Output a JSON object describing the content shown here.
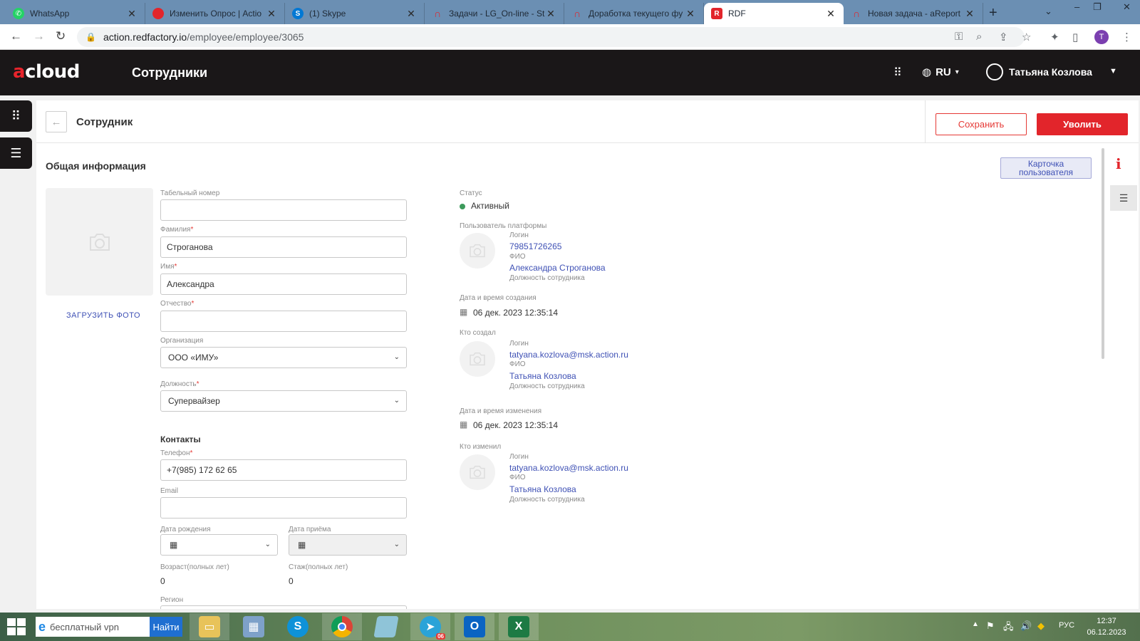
{
  "browser": {
    "tabs": [
      {
        "title": "WhatsApp",
        "icon": "whatsapp-icon",
        "color": "#25d366"
      },
      {
        "title": "Изменить Опрос | Actio",
        "icon": "action-icon",
        "color": "#e2252b"
      },
      {
        "title": "(1) Skype",
        "icon": "skype-icon",
        "color": "#0078d4"
      },
      {
        "title": "Задачи - LG_On-line - St",
        "icon": "headset-icon",
        "color": "#e2252b"
      },
      {
        "title": "Доработка текущего фу",
        "icon": "headset-icon",
        "color": "#e2252b"
      },
      {
        "title": "RDF",
        "icon": "rdf-icon",
        "color": "#e2252b"
      },
      {
        "title": "Новая задача - aReport",
        "icon": "headset-icon",
        "color": "#e2252b"
      }
    ],
    "url_host": "action.redfactory.io",
    "url_path": "/employee/employee/3065",
    "profile_initial": "T"
  },
  "app": {
    "logo_a": "a",
    "logo_rest": "cloud",
    "title": "Сотрудники",
    "lang": "RU",
    "user_name": "Татьяна Козлова"
  },
  "page": {
    "title": "Сотрудник",
    "save_label": "Сохранить",
    "fire_label": "Уволить",
    "section_title": "Общая информация",
    "user_card_label": "Карточка пользователя",
    "upload_photo": "ЗАГРУЗИТЬ ФОТО"
  },
  "form": {
    "tab_number_label": "Табельный номер",
    "tab_number": "",
    "last_name_label": "Фамилия",
    "last_name": "Строганова",
    "first_name_label": "Имя",
    "first_name": "Александра",
    "middle_name_label": "Отчество",
    "middle_name": "",
    "org_label": "Организация",
    "org": "ООО «ИМУ»",
    "position_label": "Должность",
    "position": "Супервайзер",
    "contacts_title": "Контакты",
    "phone_label": "Телефон",
    "phone": "+7(985) 172 62 65",
    "email_label": "Email",
    "email": "",
    "birth_label": "Дата рождения",
    "hire_label": "Дата приёма",
    "age_label": "Возраст(полных лет)",
    "age": "0",
    "exp_label": "Стаж(полных лет)",
    "exp": "0",
    "region_label": "Регион",
    "required_mark": "*"
  },
  "info": {
    "status_label": "Статус",
    "status": "Активный",
    "status_color": "#3d9a5b",
    "platform_user_label": "Пользователь платформы",
    "login_label": "Логин",
    "fio_label": "ФИО",
    "position_label": "Должность сотрудника",
    "platform_login": "79851726265",
    "platform_fio": "Александра Строганова",
    "created_label": "Дата и время создания",
    "created": "06 дек. 2023 12:35:14",
    "creator_label": "Кто создал",
    "creator_login": "tatyana.kozlova@msk.action.ru",
    "creator_fio": "Татьяна Козлова",
    "modified_label": "Дата и время изменения",
    "modified": "06 дек. 2023 12:35:14",
    "modifier_label": "Кто изменил",
    "modifier_login": "tatyana.kozlova@msk.action.ru",
    "modifier_fio": "Татьяна Козлова"
  },
  "taskbar": {
    "search_text": "бесплатный vpn",
    "search_button": "Найти",
    "telegram_badge": "06",
    "lang": "РУС",
    "time": "12:37",
    "date": "06.12.2023"
  }
}
